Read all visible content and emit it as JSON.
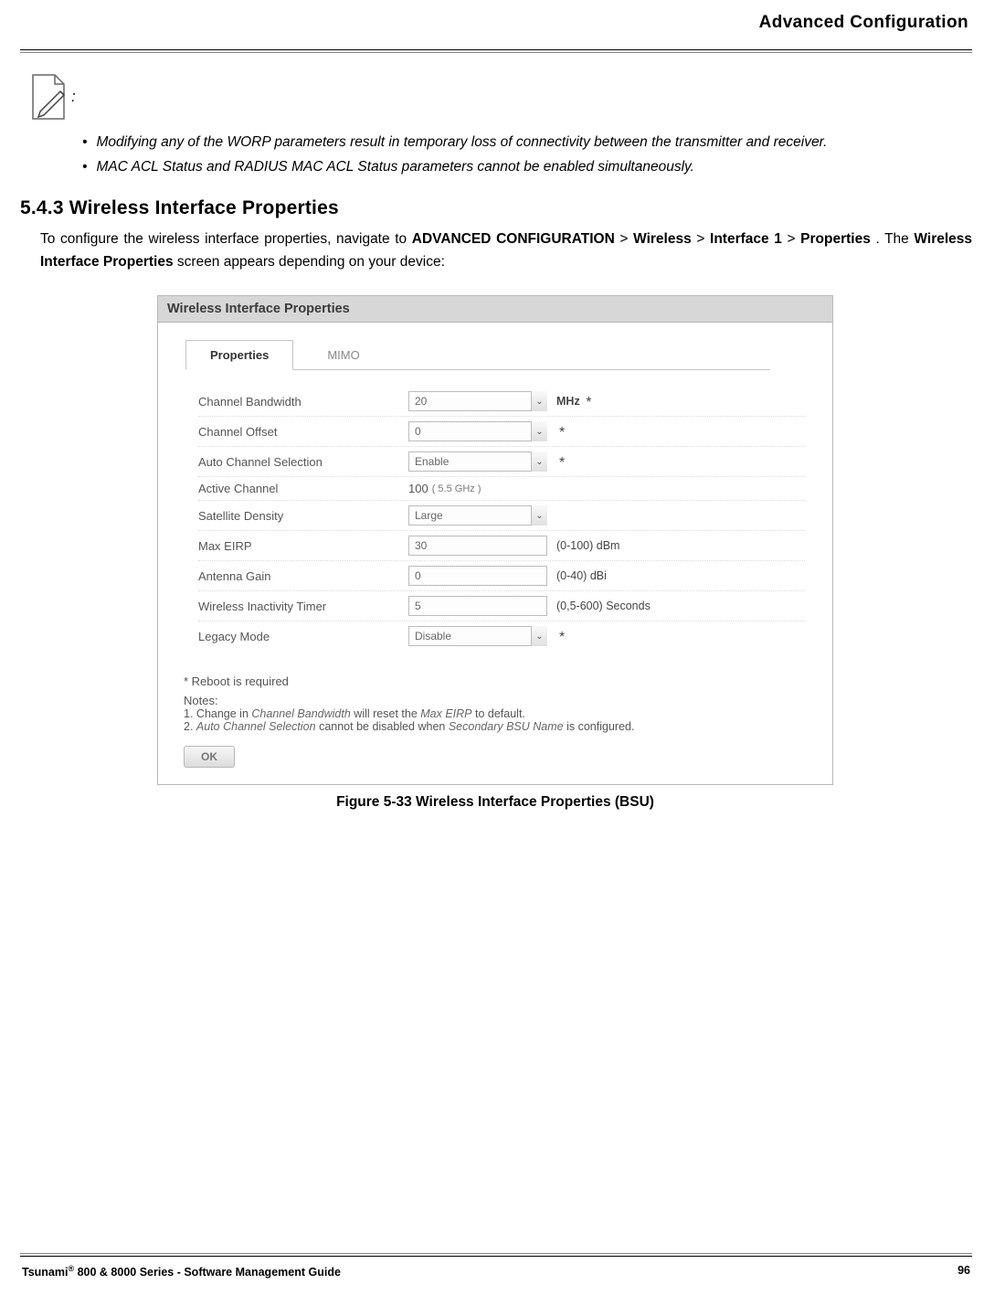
{
  "header": {
    "title": "Advanced Configuration"
  },
  "note": {
    "bullets": [
      "Modifying any of the WORP parameters result in temporary loss of connectivity between the transmitter and receiver.",
      "MAC ACL Status and RADIUS MAC ACL Status parameters cannot be enabled simultaneously."
    ]
  },
  "section": {
    "number": "5.4.3",
    "title": "Wireless Interface Properties",
    "body_parts": {
      "p1": "To configure the wireless interface properties, navigate to ",
      "b1": "ADVANCED CONFIGURATION",
      "sep": " > ",
      "b2": "Wireless",
      "b3": "Interface 1",
      "b4": "Properties",
      "p2": ". The ",
      "b5": "Wireless Interface Properties",
      "p3": " screen appears depending on your device:"
    }
  },
  "panel": {
    "title": "Wireless Interface Properties",
    "tabs": {
      "active": "Properties",
      "inactive": "MIMO"
    },
    "rows": {
      "channel_bandwidth": {
        "label": "Channel Bandwidth",
        "value": "20",
        "suffix": "MHz",
        "star": "*"
      },
      "channel_offset": {
        "label": "Channel Offset",
        "value": "0",
        "star": "*"
      },
      "auto_channel_selection": {
        "label": "Auto Channel Selection",
        "value": "Enable",
        "star": "*"
      },
      "active_channel": {
        "label": "Active Channel",
        "value": "100",
        "sub": "( 5.5 GHz )"
      },
      "satellite_density": {
        "label": "Satellite Density",
        "value": "Large"
      },
      "max_eirp": {
        "label": "Max EIRP",
        "value": "30",
        "suffix": "(0-100) dBm"
      },
      "antenna_gain": {
        "label": "Antenna Gain",
        "value": "0",
        "suffix": "(0-40) dBi"
      },
      "wireless_inactivity_timer": {
        "label": "Wireless Inactivity Timer",
        "value": "5",
        "suffix": "(0,5-600) Seconds"
      },
      "legacy_mode": {
        "label": "Legacy Mode",
        "value": "Disable",
        "star": "*"
      }
    },
    "reboot_note": "* Reboot is required",
    "notes_label": "Notes:",
    "notes": [
      {
        "num": "1.",
        "pre": "Change in ",
        "i1": "Channel Bandwidth",
        "mid": " will reset the ",
        "i2": "Max EIRP",
        "post": " to default."
      },
      {
        "num": "2.",
        "pre": "",
        "i1": "Auto Channel Selection",
        "mid": " cannot be disabled when ",
        "i2": "Secondary BSU Name",
        "post": " is configured."
      }
    ],
    "ok": "OK"
  },
  "figure_caption": "Figure 5-33 Wireless Interface Properties (BSU)",
  "footer": {
    "left_pre": "Tsunami",
    "left_post": " 800 & 8000 Series - Software Management Guide",
    "page": "96"
  }
}
